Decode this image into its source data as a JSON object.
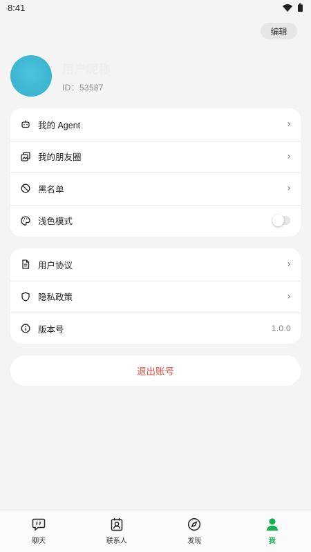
{
  "status_bar": {
    "time": "8:41",
    "icons": [
      "wifi-icon",
      "battery-icon"
    ]
  },
  "header": {
    "edit_label": "编辑"
  },
  "profile": {
    "username": "用户昵称",
    "id_text": "ID：53587"
  },
  "menu_group_1": [
    {
      "icon": "robot-icon",
      "label": "我的 Agent",
      "trailing": "›"
    },
    {
      "icon": "moments-icon",
      "label": "我的朋友圈",
      "trailing": "›"
    },
    {
      "icon": "block-icon",
      "label": "黑名单",
      "trailing": "›"
    },
    {
      "icon": "palette-icon",
      "label": "浅色模式",
      "toggle_on": false
    }
  ],
  "menu_group_2": [
    {
      "icon": "document-icon",
      "label": "用户协议",
      "trailing": "›"
    },
    {
      "icon": "shield-icon",
      "label": "隐私政策",
      "trailing": "›"
    },
    {
      "icon": "info-icon",
      "label": "版本号",
      "value": "1.0.0"
    }
  ],
  "logout_label": "退出账号",
  "tabs": [
    {
      "icon": "chat-icon",
      "label": "聊天",
      "active": false
    },
    {
      "icon": "contacts-icon",
      "label": "联系人",
      "active": false
    },
    {
      "icon": "compass-icon",
      "label": "发现",
      "active": false
    },
    {
      "icon": "person-icon",
      "label": "我",
      "active": true
    }
  ],
  "colors": {
    "accent": "#18b251",
    "danger": "#e94a3f",
    "background": "#f3f4f3",
    "avatar": "#44bad6"
  }
}
